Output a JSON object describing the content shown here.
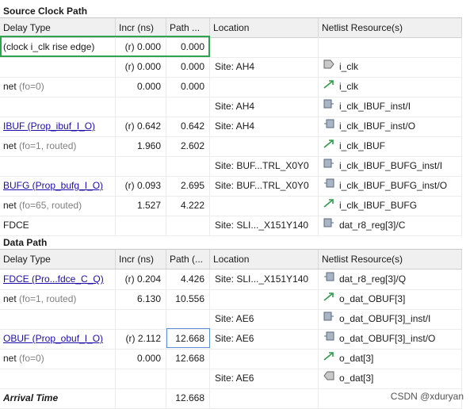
{
  "source": {
    "title": "Source Clock Path",
    "headers": [
      "Delay Type",
      "Incr (ns)",
      "Path ...",
      "Location",
      "Netlist Resource(s)"
    ],
    "rows": [
      {
        "type": "(clock i_clk rise edge)",
        "type_note": "",
        "link": false,
        "incr": "(r) 0.000",
        "path": "0.000",
        "loc": "",
        "res": "",
        "icon": ""
      },
      {
        "type": "",
        "type_note": "",
        "link": false,
        "incr": "(r) 0.000",
        "path": "0.000",
        "loc": "Site: AH4",
        "res": "i_clk",
        "icon": "port-icon"
      },
      {
        "type": "net",
        "type_note": "(fo=0)",
        "link": false,
        "incr": "0.000",
        "path": "0.000",
        "loc": "",
        "res": "i_clk",
        "icon": "net-icon"
      },
      {
        "type": "",
        "type_note": "",
        "link": false,
        "incr": "",
        "path": "",
        "loc": "Site: AH4",
        "res": "i_clk_IBUF_inst/I",
        "icon": "pin-in-icon"
      },
      {
        "type": "IBUF (Prop_ibuf_I_O)",
        "type_note": "",
        "link": true,
        "incr": "(r) 0.642",
        "path": "0.642",
        "loc": "Site: AH4",
        "res": "i_clk_IBUF_inst/O",
        "icon": "pin-out-icon"
      },
      {
        "type": "net",
        "type_note": "(fo=1, routed)",
        "link": false,
        "incr": "1.960",
        "path": "2.602",
        "loc": "",
        "res": "i_clk_IBUF",
        "icon": "net-icon"
      },
      {
        "type": "",
        "type_note": "",
        "link": false,
        "incr": "",
        "path": "",
        "loc": "Site: BUF...TRL_X0Y0",
        "res": "i_clk_IBUF_BUFG_inst/I",
        "icon": "pin-in-icon"
      },
      {
        "type": "BUFG (Prop_bufg_I_O)",
        "type_note": "",
        "link": true,
        "incr": "(r) 0.093",
        "path": "2.695",
        "loc": "Site: BUF...TRL_X0Y0",
        "res": "i_clk_IBUF_BUFG_inst/O",
        "icon": "pin-out-icon"
      },
      {
        "type": "net",
        "type_note": "(fo=65, routed)",
        "link": false,
        "incr": "1.527",
        "path": "4.222",
        "loc": "",
        "res": "i_clk_IBUF_BUFG",
        "icon": "net-icon"
      },
      {
        "type": "FDCE",
        "type_note": "",
        "link": false,
        "incr": "",
        "path": "",
        "loc": "Site: SLI..._X151Y140",
        "res": "dat_r8_reg[3]/C",
        "icon": "pin-in-icon"
      }
    ]
  },
  "data": {
    "title": "Data Path",
    "headers": [
      "Delay Type",
      "Incr (ns)",
      "Path (...",
      "Location",
      "Netlist Resource(s)"
    ],
    "rows": [
      {
        "type": "FDCE (Pro...fdce_C_Q)",
        "type_note": "",
        "link": true,
        "incr": "(r) 0.204",
        "path": "4.426",
        "loc": "Site: SLI..._X151Y140",
        "res": "dat_r8_reg[3]/Q",
        "icon": "pin-out-icon"
      },
      {
        "type": "net",
        "type_note": "(fo=1, routed)",
        "link": false,
        "incr": "6.130",
        "path": "10.556",
        "loc": "",
        "res": "o_dat_OBUF[3]",
        "icon": "net-icon"
      },
      {
        "type": "",
        "type_note": "",
        "link": false,
        "incr": "",
        "path": "",
        "loc": "Site: AE6",
        "res": "o_dat_OBUF[3]_inst/I",
        "icon": "pin-in-icon"
      },
      {
        "type": "OBUF (Prop_obuf_I_O)",
        "type_note": "",
        "link": true,
        "incr": "(r) 2.112",
        "path": "12.668",
        "loc": "Site: AE6",
        "res": "o_dat_OBUF[3]_inst/O",
        "icon": "pin-out-icon"
      },
      {
        "type": "net",
        "type_note": "(fo=0)",
        "link": false,
        "incr": "0.000",
        "path": "12.668",
        "loc": "",
        "res": "o_dat[3]",
        "icon": "net-icon"
      },
      {
        "type": "",
        "type_note": "",
        "link": false,
        "incr": "",
        "path": "",
        "loc": "Site: AE6",
        "res": "o_dat[3]",
        "icon": "port-out-icon"
      },
      {
        "type": "Arrival Time",
        "type_note": "",
        "link": false,
        "bold": true,
        "incr": "",
        "path": "12.668",
        "loc": "",
        "res": "",
        "icon": ""
      }
    ]
  },
  "watermark": "CSDN @xduryan",
  "colors": {
    "highlight_box": "#2ea44f",
    "link": "#1a0dab",
    "selected_cell": "#5b8fd6"
  }
}
